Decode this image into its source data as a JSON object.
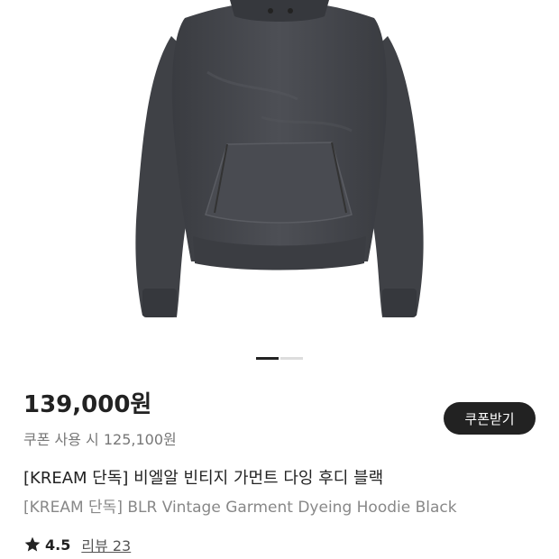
{
  "product": {
    "image_alt": "hoodie-product-image",
    "carousel": {
      "current": 1,
      "total": 2
    },
    "price": "139,000원",
    "coupon_price": "쿠폰 사용 시 125,100원",
    "coupon_button_label": "쿠폰받기",
    "title_ko": "[KREAM 단독] 비엘알 빈티지 가먼트 다잉 후디 블랙",
    "title_en": "[KREAM 단독] BLR Vintage Garment Dyeing Hoodie Black",
    "rating": "4.5",
    "review_label": "리뷰 23",
    "icons": {
      "rating": "star-icon"
    }
  },
  "colors": {
    "hoodie": "#45474c",
    "button_bg": "#222222"
  }
}
